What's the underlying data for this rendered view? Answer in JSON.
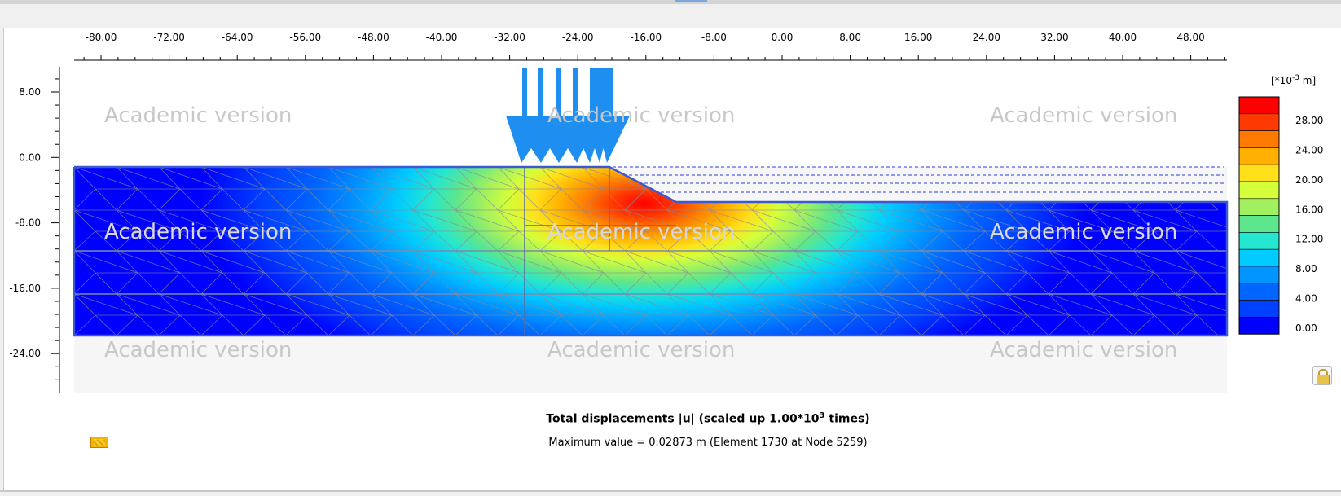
{
  "window": {
    "accent": "#7aa7e0"
  },
  "plot": {
    "x_axis_ticks": [
      "-80.00",
      "-72.00",
      "-64.00",
      "-56.00",
      "-48.00",
      "-40.00",
      "-32.00",
      "-24.00",
      "-16.00",
      "-8.00",
      "0.00",
      "8.00",
      "16.00",
      "24.00",
      "32.00",
      "40.00",
      "48.00"
    ],
    "y_axis_ticks": [
      "8.00",
      "0.00",
      "-8.00",
      "-16.00",
      "-24.00"
    ],
    "watermark": "Academic version",
    "legend": {
      "unit_prefix": "[*10",
      "unit_exp": "-3",
      "unit_suffix": " m]",
      "labels": [
        "28.00",
        "24.00",
        "20.00",
        "16.00",
        "12.00",
        "8.00",
        "4.00",
        "0.00"
      ],
      "colors": [
        "#ff0000",
        "#ff3a00",
        "#ff7a00",
        "#ffb000",
        "#ffe01a",
        "#d4ff3a",
        "#a0f060",
        "#5ee68c",
        "#25e6d0",
        "#00ccff",
        "#0095ff",
        "#0066ff",
        "#0040ff",
        "#0000ff"
      ]
    }
  },
  "caption": {
    "title_prefix": "Total displacements |u| (scaled up 1.00*10",
    "title_exp": "3",
    "title_suffix": " times)",
    "max_value": "Maximum value = 0.02873 m (Element 1730 at Node 5259)"
  },
  "icons": {
    "legend_swatch": "contour-legend-icon",
    "lock": "lock-icon"
  }
}
